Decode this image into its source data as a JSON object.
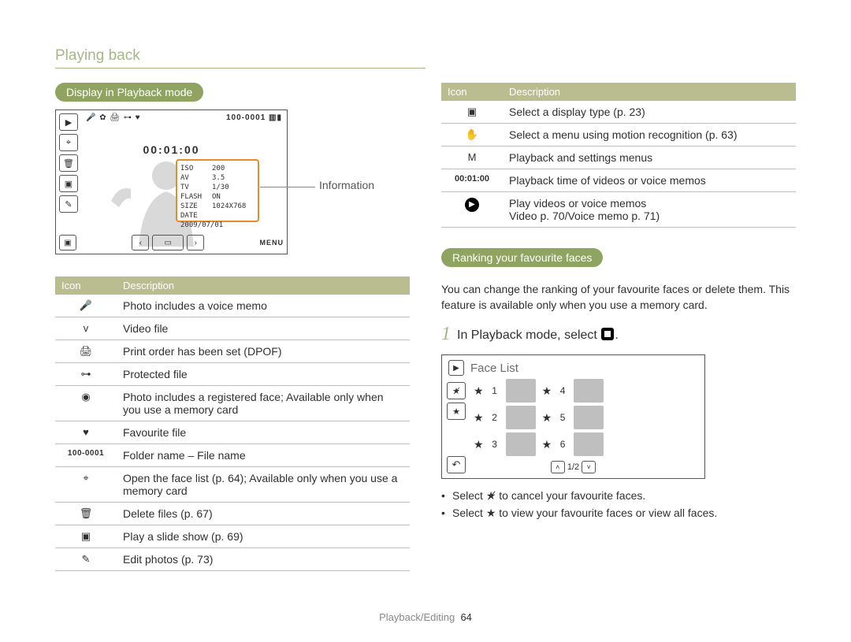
{
  "page_title": "Playing back",
  "left": {
    "section_label": "Display in Playback mode",
    "info_label": "Information",
    "shot": {
      "top_icons_text": "🎤 ✿ 🖨 ⊶ ♥",
      "folder_file": "100-0001",
      "time": "00:01:00",
      "info_rows": [
        {
          "k": "ISO",
          "v": "200"
        },
        {
          "k": "AV",
          "v": "3.5"
        },
        {
          "k": "TV",
          "v": "1/30"
        },
        {
          "k": "FLASH",
          "v": "ON"
        },
        {
          "k": "SIZE",
          "v": "1024X768"
        },
        {
          "k": "DATE",
          "v": "2009/07/01"
        }
      ],
      "menu_label": "MENU"
    },
    "table_header_icon": "Icon",
    "table_header_desc": "Description",
    "rows": [
      {
        "icon": "🎤",
        "desc": "Photo includes a voice memo"
      },
      {
        "icon": "v",
        "desc": "Video file"
      },
      {
        "icon": "🖨",
        "desc": "Print order has been set (DPOF)"
      },
      {
        "icon": "⊶",
        "desc": "Protected file"
      },
      {
        "icon": "◉",
        "desc": "Photo includes a registered face; Available only when you use a memory card"
      },
      {
        "icon": "♥",
        "desc": "Favourite file"
      },
      {
        "icon": "100-0001",
        "desc": "Folder name – File name"
      },
      {
        "icon": "⌖",
        "desc": "Open the face list (p. 64); Available only when you use a memory card"
      },
      {
        "icon": "🗑",
        "desc": "Delete files (p. 67)"
      },
      {
        "icon": "▣",
        "desc": "Play a slide show (p. 69)"
      },
      {
        "icon": "✎",
        "desc": "Edit photos (p. 73)"
      }
    ]
  },
  "right": {
    "table_header_icon": "Icon",
    "table_header_desc": "Description",
    "rows": [
      {
        "icon": "▣",
        "desc": "Select a display type (p. 23)"
      },
      {
        "icon": "✋",
        "desc": "Select a menu using motion recognition (p. 63)"
      },
      {
        "icon": "M",
        "desc": "Playback and settings menus"
      },
      {
        "icon": "00:01:00",
        "desc": "Playback time of videos or voice memos"
      },
      {
        "icon": "▶",
        "desc": "Play videos or voice memos\nVideo p. 70/Voice memo p. 71)"
      }
    ],
    "section_label": "Ranking your favourite faces",
    "intro": "You can change the ranking of your favourite faces or delete them. This feature is available only when you use a memory card.",
    "step_num": "1",
    "step_text_prefix": "In Playback mode, select ",
    "step_text_suffix": ".",
    "face_list": {
      "title": "Face List",
      "nums": [
        "1",
        "2",
        "3",
        "4",
        "5",
        "6"
      ],
      "pager": "1/2"
    },
    "bullets": [
      {
        "pre": "Select ",
        "icon": "★̸",
        "post": " to cancel your favourite faces."
      },
      {
        "pre": "Select ",
        "icon": "★",
        "post": " to view your favourite faces or view all faces."
      }
    ]
  },
  "footer": {
    "section": "Playback/Editing",
    "page": "64"
  }
}
